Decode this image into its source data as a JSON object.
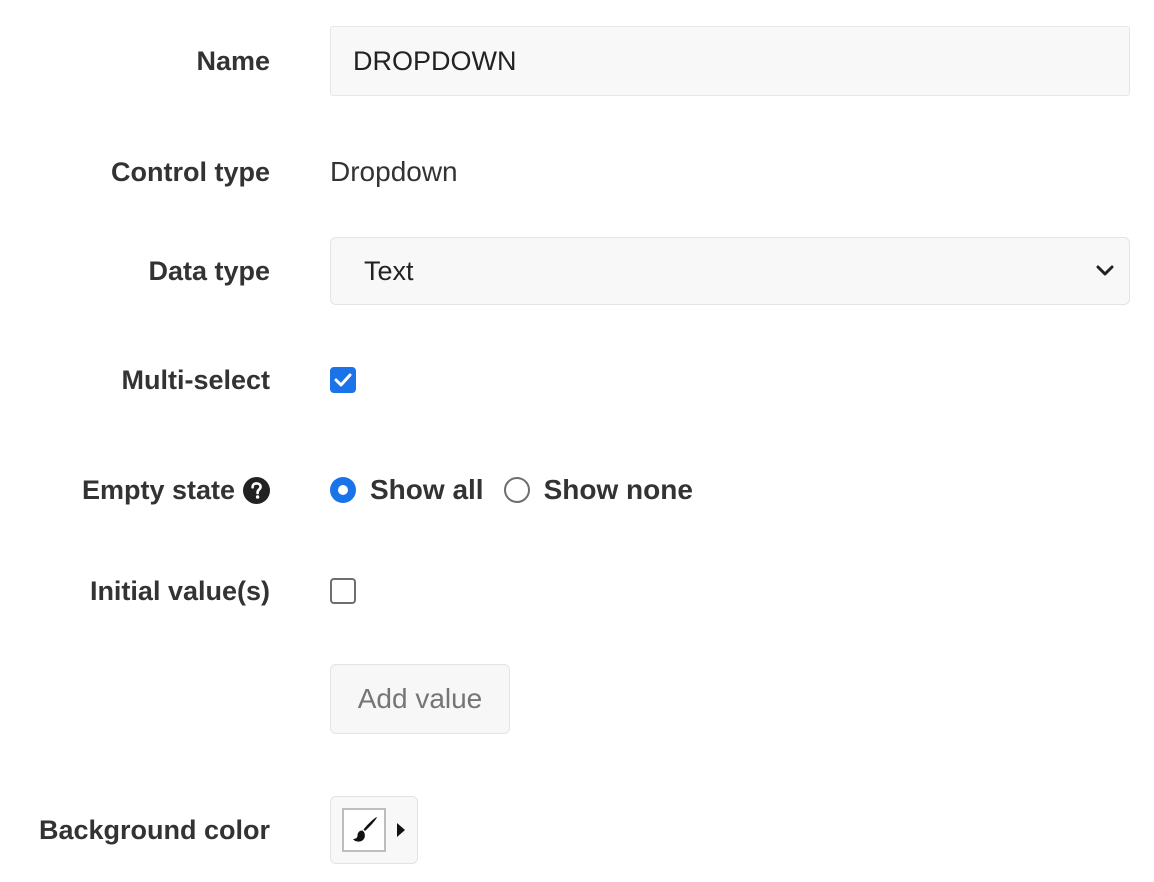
{
  "fields": {
    "name": {
      "label": "Name",
      "value": "DROPDOWN"
    },
    "control_type": {
      "label": "Control type",
      "value": "Dropdown"
    },
    "data_type": {
      "label": "Data type",
      "selected": "Text"
    },
    "multi_select": {
      "label": "Multi-select",
      "checked": true
    },
    "empty_state": {
      "label": "Empty state",
      "help_icon": "question-circle-icon",
      "options": [
        {
          "label": "Show all",
          "selected": true
        },
        {
          "label": "Show none",
          "selected": false
        }
      ]
    },
    "initial_values": {
      "label": "Initial value(s)",
      "checked": false,
      "add_button_label": "Add value"
    },
    "background_color": {
      "label": "Background color",
      "icon": "paint-brush-icon",
      "dropdown_icon": "caret-right-icon"
    }
  },
  "colors": {
    "accent": "#1a73e8",
    "label_text": "#333333",
    "input_background": "#f8f8f8"
  }
}
